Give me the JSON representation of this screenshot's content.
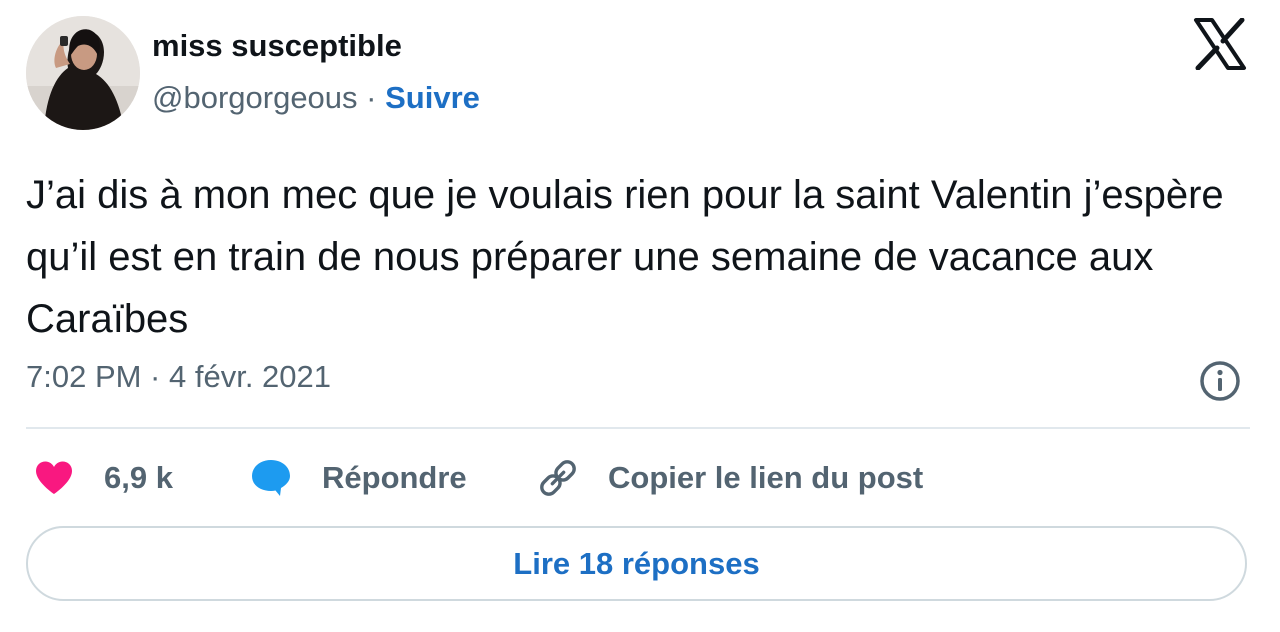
{
  "author": {
    "display_name": "miss susceptible",
    "handle": "@borgorgeous",
    "separator": " · ",
    "follow_label": "Suivre"
  },
  "tweet": {
    "text": "J’ai dis à mon mec que je voulais rien pour la saint Valentin j’espère qu’il est en train de nous préparer une semaine de vacance aux Caraïbes",
    "timestamp": "7:02 PM · 4 févr. 2021"
  },
  "actions": {
    "like_count": "6,9 k",
    "reply_label": "Répondre",
    "copy_link_label": "Copier le lien du post"
  },
  "footer": {
    "read_replies_label": "Lire 18 réponses"
  },
  "icons": {
    "brand": "x-logo-icon",
    "like": "heart-icon",
    "reply": "speech-bubble-icon",
    "copy": "link-icon",
    "info": "info-icon"
  },
  "colors": {
    "like": "#f91880",
    "reply": "#1d9bf0",
    "link_blue": "#1d6fc4",
    "muted_text": "#536471",
    "main_text": "#0f1419"
  }
}
